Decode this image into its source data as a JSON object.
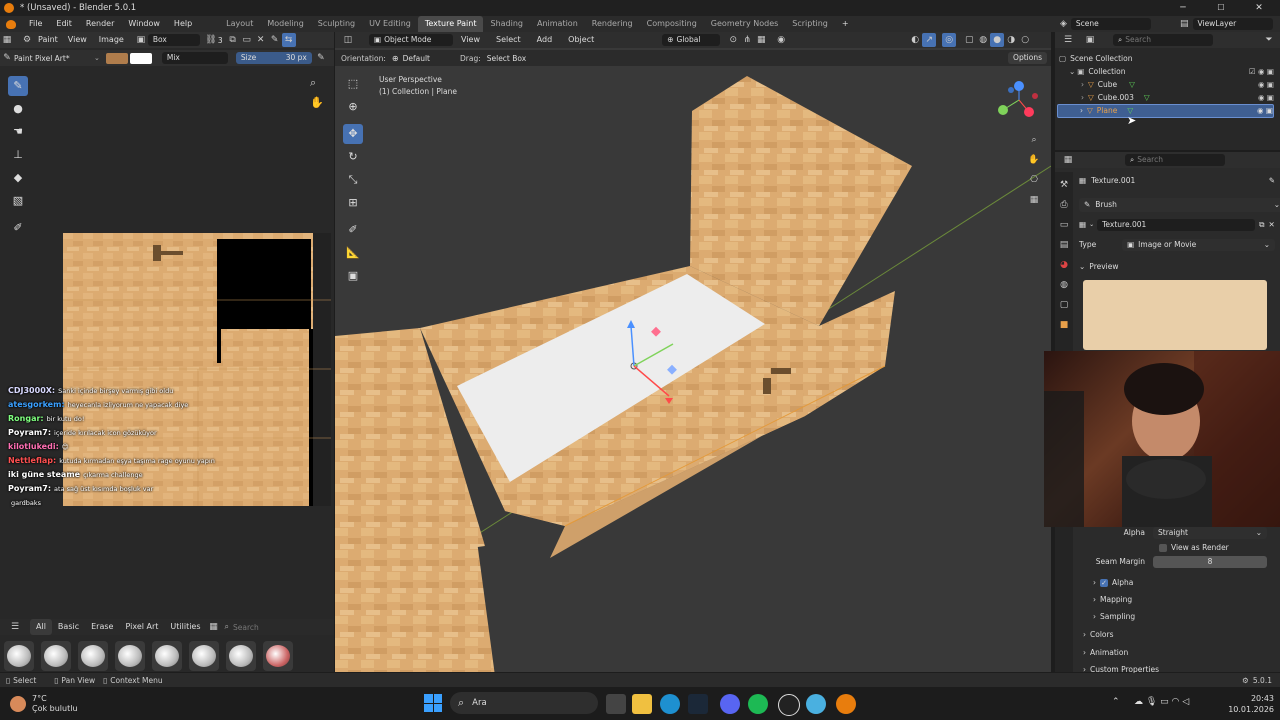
{
  "window": {
    "title": "* (Unsaved) - Blender 5.0.1",
    "min": "─",
    "max": "☐",
    "close": "✕"
  },
  "menu": [
    "File",
    "Edit",
    "Render",
    "Window",
    "Help"
  ],
  "workspaces": [
    "Layout",
    "Modeling",
    "Sculpting",
    "UV Editing",
    "Texture Paint",
    "Shading",
    "Animation",
    "Rendering",
    "Compositing",
    "Geometry Nodes",
    "Scripting"
  ],
  "workspace_add": "+",
  "scene": {
    "label": "Scene",
    "viewlayer": "ViewLayer"
  },
  "image_editor": {
    "mode": "Paint",
    "menus": [
      "View",
      "Image"
    ],
    "image_name": "Box",
    "user_count": "3",
    "brush_name": "Paint Pixel Art*",
    "blend": "Mix",
    "size_label": "Size",
    "size_value": "30 px"
  },
  "chat": [
    {
      "user": "CDJ3000X:",
      "msg": "Sanki içinde birşey varmış gibi oldu",
      "color": "#d9d9ff"
    },
    {
      "user": "atesgorkem:",
      "msg": "heyecanla izliyorum ne yapacak diye",
      "color": "#3aa0ff"
    },
    {
      "user": "Rongar:",
      "msg": "bir kutu do!",
      "color": "#7fff7f"
    },
    {
      "user": "Poyram7:",
      "msg": "içeride kırılacak icon gözüküyor",
      "color": "#ffffff"
    },
    {
      "user": "kilotlukedi:",
      "msg": "😊",
      "color": "#ff6fb3"
    },
    {
      "user": "Nettleflap:",
      "msg": "kutuda kırmadan eşya taşıma rage oyunu yapın",
      "color": "#ff5050"
    },
    {
      "user": "iki güne steame",
      "msg": "çıkarma challenge",
      "color": "#ffffff"
    },
    {
      "user": "Poyram7:",
      "msg": "ata sağ üst kısımda boşluk var",
      "color": "#ffffff"
    },
    {
      "user": "",
      "msg": "gardbaks",
      "color": "#ff4466"
    }
  ],
  "brush_shelf": {
    "tabs": [
      "All",
      "Basic",
      "Erase",
      "Pixel Art",
      "Utilities"
    ],
    "search_placeholder": "Search"
  },
  "viewport": {
    "mode": "Object Mode",
    "menus": [
      "View",
      "Select",
      "Add",
      "Object"
    ],
    "transform": "Global",
    "orientation_label": "Orientation:",
    "orientation_value": "Default",
    "drag_label": "Drag:",
    "drag_value": "Select Box",
    "options": "Options",
    "overlay_line1": "User Perspective",
    "overlay_line2": "(1) Collection | Plane"
  },
  "outliner": {
    "search_placeholder": "Search",
    "root": "Scene Collection",
    "collection": "Collection",
    "items": [
      "Cube",
      "Cube.003",
      "Plane"
    ]
  },
  "properties": {
    "search_placeholder": "Search",
    "texture_name": "Texture.001",
    "brush_label": "Brush",
    "slot_name": "Texture.001",
    "type_label": "Type",
    "type_value": "Image or Movie",
    "preview_label": "Preview",
    "alpha_label": "Alpha",
    "alpha_value": "Straight",
    "view_as_render": "View as Render",
    "seam_margin_label": "Seam Margin",
    "seam_margin_value": "8",
    "sections": [
      "Alpha",
      "Mapping",
      "Sampling",
      "Colors",
      "Animation",
      "Custom Properties"
    ]
  },
  "status": {
    "select": "Select",
    "pan": "Pan View",
    "context": "Context Menu",
    "version": "5.0.1"
  },
  "taskbar": {
    "weather_temp": "7°C",
    "weather_desc": "Çok bulutlu",
    "search": "Ara",
    "time": "20:43",
    "date": "10.01.2026"
  },
  "colors": {
    "accent": "#4772b3",
    "wood": "#dcab71",
    "blender_orange": "#e87d0d"
  }
}
